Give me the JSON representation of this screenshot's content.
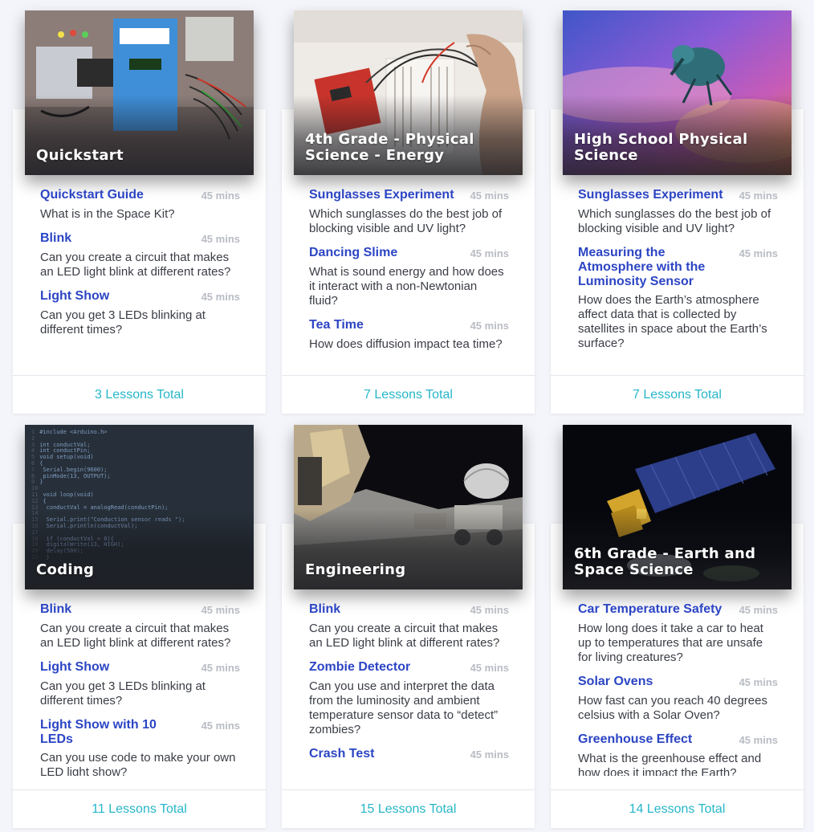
{
  "courses": [
    {
      "title": "Quickstart",
      "total": "3 Lessons Total",
      "lessons": [
        {
          "name": "Quickstart Guide",
          "duration": "45 mins",
          "desc": "What is in the Space Kit?"
        },
        {
          "name": "Blink",
          "duration": "45 mins",
          "desc": "Can you create a circuit that makes an LED light blink at different rates?"
        },
        {
          "name": "Light Show",
          "duration": "45 mins",
          "desc": "Can you get 3 LEDs blinking at different times?"
        }
      ]
    },
    {
      "title": "4th Grade - Physical Science - Energy",
      "total": "7 Lessons Total",
      "lessons": [
        {
          "name": "Sunglasses Experiment",
          "duration": "45 mins",
          "desc": "Which sunglasses do the best job of blocking visible and UV light?"
        },
        {
          "name": "Dancing Slime",
          "duration": "45 mins",
          "desc": "What is sound energy and how does it interact with a non-Newtonian fluid?"
        },
        {
          "name": "Tea Time",
          "duration": "45 mins",
          "desc": "How does diffusion impact tea time?"
        }
      ]
    },
    {
      "title": "High School Physical Science",
      "total": "7 Lessons Total",
      "lessons": [
        {
          "name": "Sunglasses Experiment",
          "duration": "45 mins",
          "desc": "Which sunglasses do the best job of blocking visible and UV light?"
        },
        {
          "name": "Measuring the Atmosphere with the Luminosity Sensor",
          "duration": "45 mins",
          "desc": "How does the Earth’s atmosphere affect data that is collected by satellites in space about the Earth’s surface?"
        }
      ]
    },
    {
      "title": "Coding",
      "total": "11 Lessons Total",
      "lessons": [
        {
          "name": "Blink",
          "duration": "45 mins",
          "desc": "Can you create a circuit that makes an LED light blink at different rates?"
        },
        {
          "name": "Light Show",
          "duration": "45 mins",
          "desc": "Can you get 3 LEDs blinking at different times?"
        },
        {
          "name": "Light Show with 10 LEDs",
          "duration": "45 mins",
          "desc": "Can you use code to make your own LED light show?"
        }
      ]
    },
    {
      "title": "Engineering",
      "total": "15 Lessons Total",
      "lessons": [
        {
          "name": "Blink",
          "duration": "45 mins",
          "desc": "Can you create a circuit that makes an LED light blink at different rates?"
        },
        {
          "name": "Zombie Detector",
          "duration": "45 mins",
          "desc": "Can you use and interpret the data from the luminosity and ambient temperature sensor data to “detect” zombies?"
        },
        {
          "name": "Crash Test",
          "duration": "45 mins",
          "desc": ""
        }
      ]
    },
    {
      "title": "6th Grade - Earth and Space Science",
      "total": "14 Lessons Total",
      "lessons": [
        {
          "name": "Car Temperature Safety",
          "duration": "45 mins",
          "desc": "How long does it take a car to heat up to temperatures that are unsafe for living creatures?"
        },
        {
          "name": "Solar Ovens",
          "duration": "45 mins",
          "desc": "How fast can you reach 40 degrees celsius with a Solar Oven?"
        },
        {
          "name": "Greenhouse Effect",
          "duration": "45 mins",
          "desc": "What is the greenhouse effect and how does it impact the Earth?"
        }
      ]
    }
  ],
  "code_snippet": [
    "#include <Arduino.h>",
    "",
    "int conductVal;",
    "int conductPin;",
    "void setup(void)",
    "{",
    "  Serial.begin(9600);",
    "  pinMode(13, OUTPUT);",
    "}",
    "",
    "void loop(void)",
    "{",
    "  conductVal = analogRead(conductPin);",
    "",
    "  Serial.print(\"Conduction sensor reads \");",
    "  Serial.println(conductVal);",
    "",
    "  if (conductVal > 0){",
    "    digitalWrite(13, HIGH);",
    "    delay(500);",
    "  }"
  ]
}
